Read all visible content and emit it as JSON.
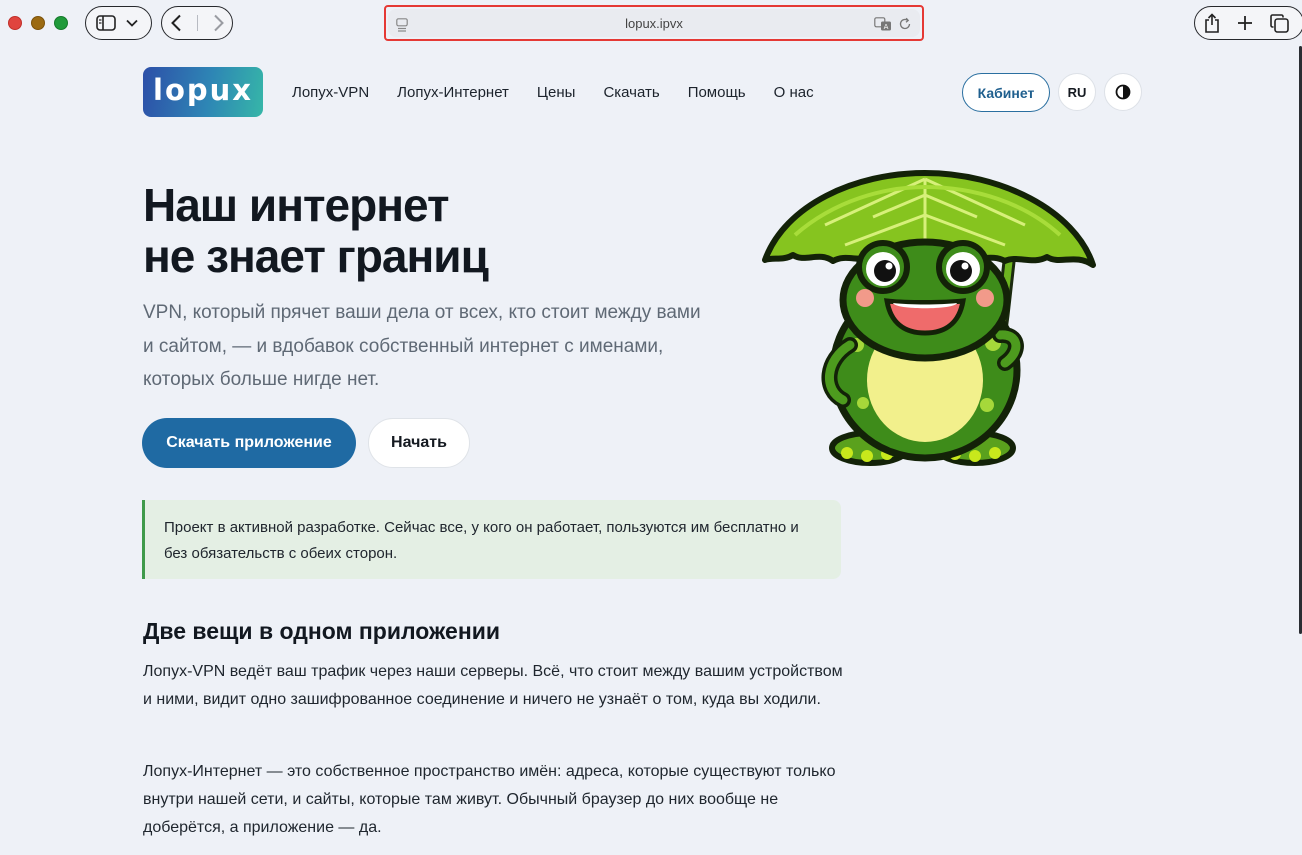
{
  "browser": {
    "url": "lopux.ipvx",
    "accent": "#e53935"
  },
  "header": {
    "logo_text": "lopux",
    "nav": [
      "Лопух-VPN",
      "Лопух-Интернет",
      "Цены",
      "Скачать",
      "Помощь",
      "О нас"
    ],
    "cabinet_label": "Кабинет",
    "lang_label": "RU",
    "theme_icon": "contrast-icon"
  },
  "hero": {
    "title_line1": "Наш интернет",
    "title_line2": "не знает границ",
    "subtitle": "VPN, который прячет ваши дела от всех, кто стоит между вами и сайтом, — и вдобавок собственный интернет с именами, которых больше нигде нет.",
    "download_label": "Скачать приложение",
    "start_label": "Начать",
    "mascot_icon": "frog-mascot-icon"
  },
  "notice": {
    "text": "Проект в активной разработке. Сейчас все, у кого он работает, пользуются им бесплатно и без обязательств с обеих сторон."
  },
  "features": {
    "title": "Две вещи в одном приложении",
    "p1": "Лопух-VPN ведёт ваш трафик через наши серверы. Всё, что стоит между вашим устройством и ними, видит одно зашифрованное соединение и ничего не узнаёт о том, куда вы ходили.",
    "p2": "Лопух-Интернет — это собственное пространство имён: адреса, которые существуют только внутри нашей сети, и сайты, которые там живут. Обычный браузер до них вообще не доберётся, а приложение — да."
  },
  "colors": {
    "primary": "#1f6aa3",
    "notice_bg": "#e4efe4",
    "notice_border": "#3f9a4a",
    "page_bg": "#eef1f7"
  }
}
